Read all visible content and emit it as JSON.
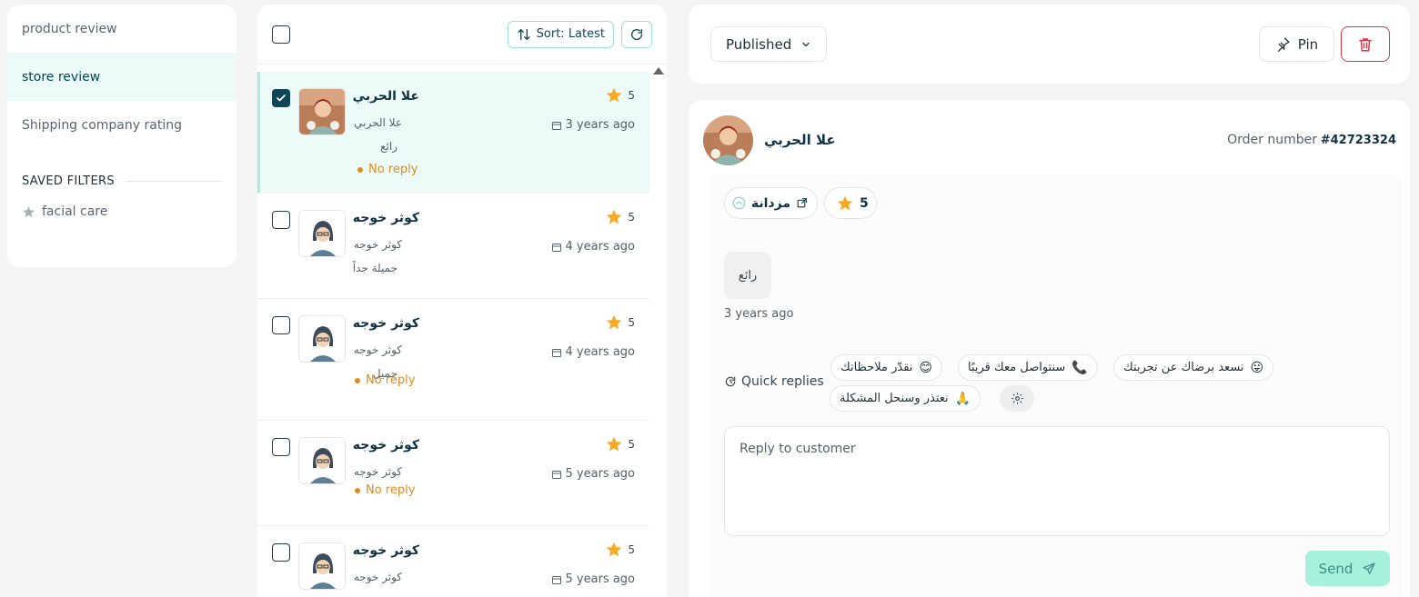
{
  "filters": {
    "items": [
      {
        "label": "product review"
      },
      {
        "label": "store review"
      },
      {
        "label": "Shipping company rating"
      }
    ],
    "saved_heading": "SAVED FILTERS",
    "saved_items": [
      {
        "label": "facial care",
        "icon": "star-icon"
      }
    ]
  },
  "list_toolbar": {
    "sort_label": "Sort: Latest",
    "refresh_icon": "refresh-icon"
  },
  "reviews": [
    {
      "name": "علا الحربي",
      "sub": "علا الحربي",
      "text": "رائع",
      "rating": "5",
      "date": "3 years ago",
      "status": "No reply",
      "checked": true,
      "avatar": "photo"
    },
    {
      "name": "كوثر خوجه",
      "sub": "كوثر خوجه",
      "text": "جميلة جداً",
      "rating": "5",
      "date": "4 years ago",
      "status": "",
      "checked": false,
      "avatar": "placeholder"
    },
    {
      "name": "كوثر خوجه",
      "sub": "كوثر خوجه",
      "text": "جميل",
      "rating": "5",
      "date": "4 years ago",
      "status": "No reply",
      "checked": false,
      "avatar": "placeholder"
    },
    {
      "name": "كوثر خوجه",
      "sub": "كوثر خوجه",
      "text": "",
      "rating": "5",
      "date": "5 years ago",
      "status": "No reply",
      "checked": false,
      "avatar": "placeholder"
    },
    {
      "name": "كوثر خوجه",
      "sub": "كوثر خوجه",
      "text": "",
      "rating": "5",
      "date": "5 years ago",
      "status": "",
      "checked": false,
      "avatar": "placeholder"
    }
  ],
  "topbar": {
    "status_value": "Published",
    "pin_label": "Pin"
  },
  "detail": {
    "customer_name": "علا الحربي",
    "order_label": "Order number",
    "order_number": "#42723324",
    "store_chip": "مزدانة",
    "rating": "5",
    "review_text": "رائع",
    "review_time": "3 years ago",
    "quick_replies_label": "Quick replies",
    "quick_replies": [
      {
        "text": "نسعد برضاك عن تجربتك",
        "emoji": "😛"
      },
      {
        "text": "سنتواصل معك قريبًا",
        "emoji": "📞"
      },
      {
        "text": "نقدّر ملاحظاتك",
        "emoji": "😊"
      },
      {
        "text": "نعتذر وسنحل المشكلة",
        "emoji": "🙏"
      }
    ],
    "reply_placeholder": "Reply to customer",
    "send_label": "Send"
  },
  "colors": {
    "accent": "#0f4558",
    "selected_row_bg": "#ecfbf8",
    "no_reply": "#e08a1b",
    "star": "#f7a928",
    "delete": "#d43a45",
    "send_bg": "#a6f0dc"
  }
}
